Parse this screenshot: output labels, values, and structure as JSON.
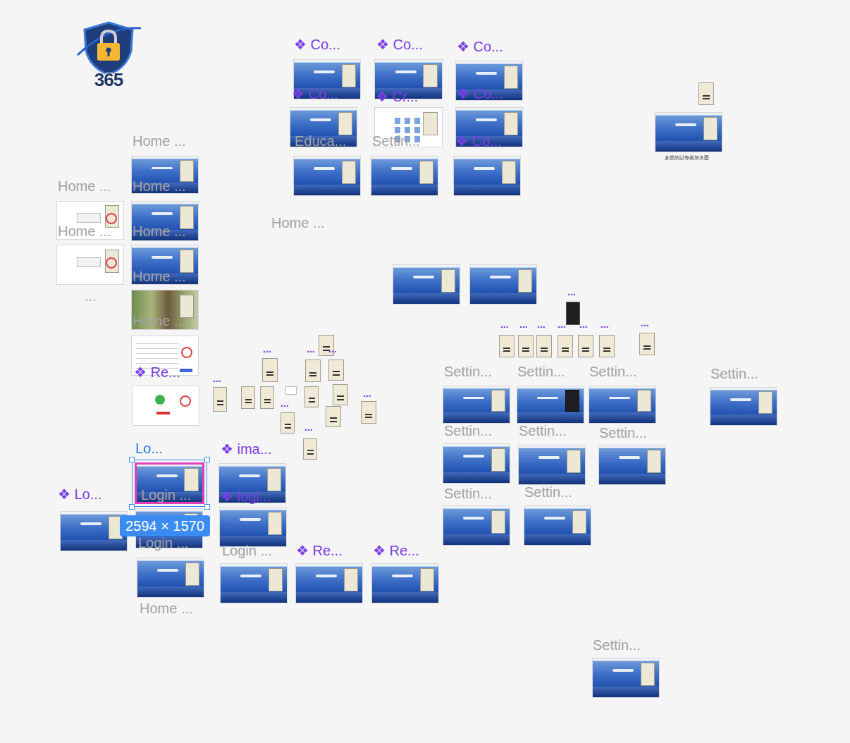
{
  "logo": {
    "text": "365"
  },
  "labels": [
    {
      "text": "❖ Co...",
      "kind": "component"
    },
    {
      "text": "❖ Co...",
      "kind": "component"
    },
    {
      "text": "❖ Co...",
      "kind": "component"
    },
    {
      "text": "❖ Co...",
      "kind": "component"
    },
    {
      "text": "Educa...",
      "kind": "page"
    },
    {
      "text": "❖ Cr...",
      "kind": "component"
    },
    {
      "text": "Settin...",
      "kind": "page"
    },
    {
      "text": "❖ Co...",
      "kind": "component"
    },
    {
      "text": "❖ Co...",
      "kind": "component"
    },
    {
      "text": "Home ...",
      "kind": "page"
    },
    {
      "text": "Home ...",
      "kind": "page"
    },
    {
      "text": "Home ...",
      "kind": "page"
    },
    {
      "text": "Home ...",
      "kind": "page"
    },
    {
      "text": "Home ...",
      "kind": "page"
    },
    {
      "text": "...",
      "kind": "page"
    },
    {
      "text": "Home ...",
      "kind": "page"
    },
    {
      "text": "Home ...",
      "kind": "page"
    },
    {
      "text": "❖ Re...",
      "kind": "component"
    },
    {
      "text": "Home ...",
      "kind": "page"
    },
    {
      "text": "Lo...",
      "kind": "selected"
    },
    {
      "text": "❖ ima...",
      "kind": "component"
    },
    {
      "text": "❖ Lo...",
      "kind": "component"
    },
    {
      "text": "Login ...",
      "kind": "page"
    },
    {
      "text": "❖ logi...",
      "kind": "component"
    },
    {
      "text": "Login ...",
      "kind": "page"
    },
    {
      "text": "Home ...",
      "kind": "page"
    },
    {
      "text": "Login ...",
      "kind": "page"
    },
    {
      "text": "❖ Re...",
      "kind": "component"
    },
    {
      "text": "❖ Re...",
      "kind": "component"
    },
    {
      "text": "Settin...",
      "kind": "page"
    },
    {
      "text": "Settin...",
      "kind": "page"
    },
    {
      "text": "Settin...",
      "kind": "page"
    },
    {
      "text": "Settin...",
      "kind": "page"
    },
    {
      "text": "Settin...",
      "kind": "page"
    },
    {
      "text": "Settin...",
      "kind": "page"
    },
    {
      "text": "Settin...",
      "kind": "page"
    },
    {
      "text": "Settin...",
      "kind": "page"
    },
    {
      "text": "Settin...",
      "kind": "page"
    },
    {
      "text": "Settin...",
      "kind": "page"
    },
    {
      "text": "...",
      "kind": "dots"
    },
    {
      "text": "...",
      "kind": "dots"
    },
    {
      "text": "...",
      "kind": "dots"
    },
    {
      "text": "...",
      "kind": "dots"
    },
    {
      "text": "...",
      "kind": "dots"
    },
    {
      "text": "...",
      "kind": "dots"
    },
    {
      "text": "...",
      "kind": "dots"
    },
    {
      "text": "...",
      "kind": "dots"
    },
    {
      "text": "...",
      "kind": "dots"
    },
    {
      "text": "...",
      "kind": "dots"
    },
    {
      "text": "...",
      "kind": "dots"
    },
    {
      "text": "...",
      "kind": "dots"
    },
    {
      "text": "...",
      "kind": "dots"
    },
    {
      "text": "...",
      "kind": "dots"
    },
    {
      "text": "...",
      "kind": "dots"
    }
  ],
  "frames": [
    {
      "kind": "ocean",
      "selected": false
    },
    {
      "kind": "ocean",
      "selected": false
    },
    {
      "kind": "ocean",
      "selected": false
    },
    {
      "kind": "ocean",
      "selected": false
    },
    {
      "kind": "files",
      "selected": false
    },
    {
      "kind": "ocean",
      "selected": false
    },
    {
      "kind": "ocean",
      "selected": false
    },
    {
      "kind": "ocean",
      "selected": false
    },
    {
      "kind": "ocean",
      "selected": false
    },
    {
      "kind": "ocean",
      "selected": false
    },
    {
      "kind": "white",
      "selected": false
    },
    {
      "kind": "ocean",
      "selected": false
    },
    {
      "kind": "white",
      "selected": false
    },
    {
      "kind": "ocean",
      "selected": false
    },
    {
      "kind": "photo",
      "selected": false
    },
    {
      "kind": "table",
      "selected": false
    },
    {
      "kind": "check",
      "selected": false
    },
    {
      "kind": "ocean",
      "selected": false
    },
    {
      "kind": "card",
      "selected": false
    },
    {
      "kind": "ocean",
      "selected": false
    },
    {
      "kind": "ocean",
      "selected": false
    },
    {
      "kind": "phone",
      "selected": false
    },
    {
      "kind": "card",
      "selected": false
    },
    {
      "kind": "card",
      "selected": false
    },
    {
      "kind": "card",
      "selected": false
    },
    {
      "kind": "card",
      "selected": false
    },
    {
      "kind": "card",
      "selected": false
    },
    {
      "kind": "card",
      "selected": false
    },
    {
      "kind": "card",
      "selected": false
    },
    {
      "kind": "card",
      "selected": false
    },
    {
      "kind": "card",
      "selected": false
    },
    {
      "kind": "card",
      "selected": false
    },
    {
      "kind": "card",
      "selected": false
    },
    {
      "kind": "card",
      "selected": false
    },
    {
      "kind": "card",
      "selected": false
    },
    {
      "kind": "card",
      "selected": false
    },
    {
      "kind": "card",
      "selected": false
    },
    {
      "kind": "card",
      "selected": false
    },
    {
      "kind": "card",
      "selected": false
    },
    {
      "kind": "card",
      "selected": false
    },
    {
      "kind": "card",
      "selected": false
    },
    {
      "kind": "card",
      "selected": false
    },
    {
      "kind": "blank",
      "selected": false
    },
    {
      "kind": "ocean",
      "selected": false
    },
    {
      "kind": "dark",
      "selected": false
    },
    {
      "kind": "ocean",
      "selected": false
    },
    {
      "kind": "ocean",
      "selected": false
    },
    {
      "kind": "ocean",
      "selected": false
    },
    {
      "kind": "ocean",
      "selected": false
    },
    {
      "kind": "ocean",
      "selected": false
    },
    {
      "kind": "ocean",
      "selected": false
    },
    {
      "kind": "ocean",
      "selected": false
    },
    {
      "kind": "ocean",
      "selected": false
    },
    {
      "kind": "ocean",
      "selected": false
    },
    {
      "kind": "ocean",
      "selected": true
    },
    {
      "kind": "ocean",
      "selected": false
    },
    {
      "kind": "ocean",
      "selected": false
    },
    {
      "kind": "ocean",
      "selected": false
    },
    {
      "kind": "ocean",
      "selected": false
    },
    {
      "kind": "ocean",
      "selected": false
    },
    {
      "kind": "ocean",
      "selected": false
    },
    {
      "kind": "ocean",
      "selected": false
    }
  ],
  "selection_size": "2594 × 1570",
  "caption": "多类的以每最加水图"
}
